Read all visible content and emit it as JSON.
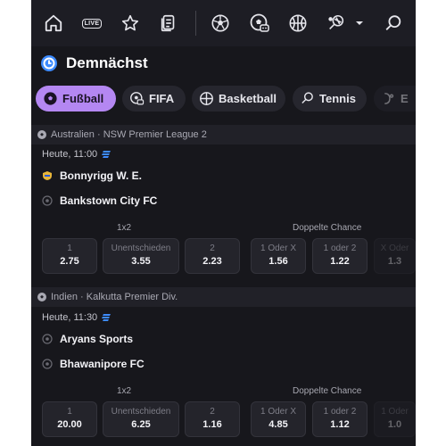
{
  "nav": {
    "items": [
      {
        "name": "home-icon"
      },
      {
        "name": "live-icon",
        "label": "LIVE"
      },
      {
        "name": "star-icon"
      },
      {
        "name": "betslip-icon"
      },
      {
        "name": "soccer-icon"
      },
      {
        "name": "fifa-icon"
      },
      {
        "name": "basketball-icon"
      },
      {
        "name": "tennis-icon"
      },
      {
        "name": "chevron-down-icon"
      },
      {
        "name": "search-icon"
      }
    ]
  },
  "section": {
    "title": "Demnächst"
  },
  "chips": [
    {
      "label": "Fußball",
      "active": true
    },
    {
      "label": "FIFA"
    },
    {
      "label": "Basketball"
    },
    {
      "label": "Tennis"
    },
    {
      "label": "E"
    }
  ],
  "matches": [
    {
      "league": "Australien · NSW Premier League 2",
      "time": "Heute, 11:00",
      "home": "Bonnyrigg W. E.",
      "away": "Bankstown City FC",
      "market1": "1x2",
      "market2": "Doppelte Chance",
      "odds": [
        {
          "label": "1",
          "value": "2.75"
        },
        {
          "label": "Unentschieden",
          "value": "3.55"
        },
        {
          "label": "2",
          "value": "2.23"
        },
        {
          "label": "1 Oder X",
          "value": "1.56"
        },
        {
          "label": "1 oder 2",
          "value": "1.22"
        },
        {
          "label": "X Oder",
          "value": "1.3"
        }
      ]
    },
    {
      "league": "Indien · Kalkutta Premier Div.",
      "time": "Heute, 11:30",
      "home": "Aryans Sports",
      "away": "Bhawanipore FC",
      "market1": "1x2",
      "market2": "Doppelte Chance",
      "odds": [
        {
          "label": "1",
          "value": "20.00"
        },
        {
          "label": "Unentschieden",
          "value": "6.25"
        },
        {
          "label": "2",
          "value": "1.16"
        },
        {
          "label": "1 Oder X",
          "value": "4.85"
        },
        {
          "label": "1 oder 2",
          "value": "1.12"
        },
        {
          "label": "1 Oder",
          "value": "1.0"
        }
      ]
    }
  ],
  "colors": {
    "accent": "#b487f2",
    "background": "#17171c",
    "live_blue": "#3d8bff"
  }
}
